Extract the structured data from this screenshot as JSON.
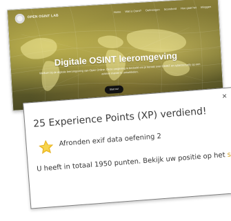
{
  "site": {
    "logo_text": "OPEN OSINT LAB",
    "nav": [
      "Home",
      "Wat is Osint?",
      "Oefeningen",
      "Scorebord",
      "Hoe gaat het",
      "Inloggen"
    ],
    "hero": {
      "title": "Digitale OSINT leeromgeving",
      "subtitle": "Welkom bij de digitale leeromgeving van Open Online. Deze omgeving is bedoeld om je kennis over OSINT en cybersecurity op een actieve manier te ontwikkelen.",
      "button": "Start nu!"
    }
  },
  "notification": {
    "close_symbol": "×",
    "title": "25 Experience Points (XP) verdiend!",
    "item": "Afronden exif data oefening 2",
    "body_prefix": "U heeft in totaal 1950 punten. Bekijk uw positie op het ",
    "scoreboard_link": "scorebord",
    "body_suffix": "."
  },
  "colors": {
    "link": "#d3a329",
    "star": "#f2c32a"
  },
  "icons": {
    "logo": "globe-logo-icon",
    "close": "close-icon",
    "star": "star-icon"
  }
}
